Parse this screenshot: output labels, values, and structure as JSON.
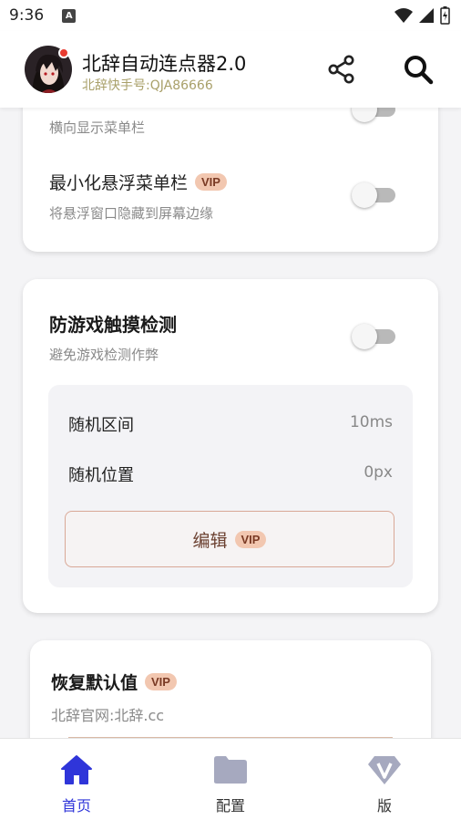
{
  "status_bar": {
    "time": "9:36",
    "indicator": "A"
  },
  "header": {
    "title": "北辞自动连点器2.0",
    "subtitle": "北辞快手号:QJA86666"
  },
  "card_menu": {
    "row1": {
      "desc": "横向显示菜单栏"
    },
    "row2": {
      "title": "最小化悬浮菜单栏",
      "badge": "VIP",
      "desc": "将悬浮窗口隐藏到屏幕边缘"
    }
  },
  "card_anti": {
    "title": "防游戏触摸检测",
    "desc": "避免游戏检测作弊",
    "random_range_label": "随机区间",
    "random_range_value": "10ms",
    "random_pos_label": "随机位置",
    "random_pos_value": "0px",
    "edit_label": "编辑",
    "edit_badge": "VIP"
  },
  "card_reset": {
    "title": "恢复默认值",
    "badge": "VIP",
    "desc": "北辞官网:北辞.cc"
  },
  "bottom_nav": {
    "home": "首页",
    "config": "配置",
    "version": "版"
  },
  "colors": {
    "accent": "#2f35d9",
    "vip_bg": "#f2c7b0",
    "vip_text": "#7a3a24",
    "subtitle": "#a9a06a"
  },
  "icons": [
    "share-icon",
    "search-icon",
    "home-icon",
    "folder-icon",
    "vip-diamond-icon"
  ],
  "toggles": {
    "horizontal_menu": false,
    "minimize_menu": false,
    "anti_detect": false
  }
}
